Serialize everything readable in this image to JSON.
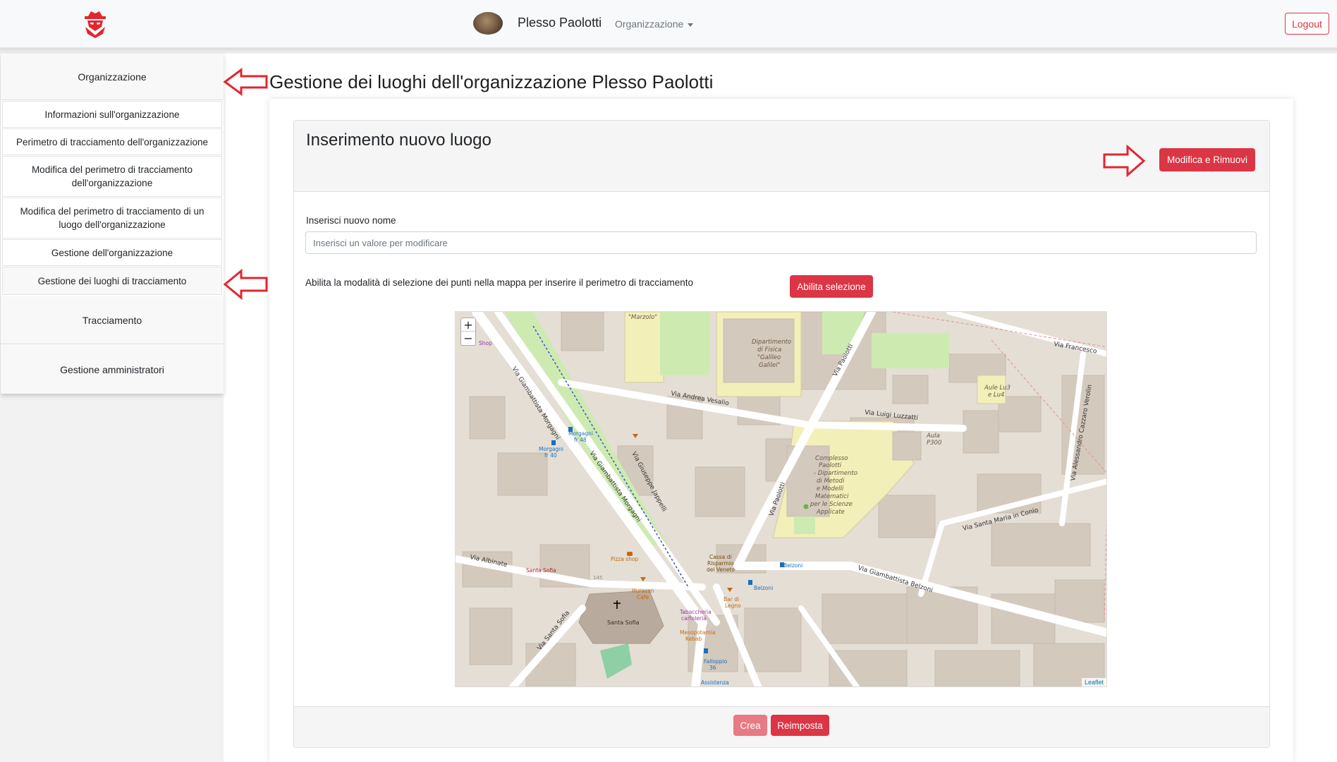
{
  "navbar": {
    "org_name": "Plesso Paolotti",
    "dropdown_label": "Organizzazione",
    "logout_label": "Logout"
  },
  "sidebar": {
    "section_org": "Organizzazione",
    "items": [
      {
        "label": "Informazioni sull'organizzazione"
      },
      {
        "label": "Perimetro di tracciamento dell'organizzazione"
      },
      {
        "label": "Modifica del perimetro di tracciamento dell'organizzazione"
      },
      {
        "label": "Modifica del perimetro di tracciamento di un luogo dell'organizzazione"
      },
      {
        "label": "Gestione dell'organizzazione"
      },
      {
        "label": "Gestione dei luoghi di tracciamento"
      }
    ],
    "section_tracking": "Tracciamento",
    "section_admins": "Gestione amministratori"
  },
  "main": {
    "page_title": "Gestione dei luoghi dell'organizzazione Plesso Paolotti",
    "card_title": "Inserimento nuovo luogo",
    "edit_remove_label": "Modifica e Rimuovi",
    "name_label": "Inserisci nuovo nome",
    "name_placeholder": "Inserisci un valore per modificare",
    "select_mode_text": "Abilita la modalità di selezione dei punti nella mappa per inserire il perimetro di tracciamento",
    "enable_selection_label": "Abilita selezione",
    "create_label": "Crea",
    "reset_label": "Reimposta"
  },
  "map": {
    "zoom_in": "+",
    "zoom_out": "−",
    "attribution": "Leaflet",
    "labels": {
      "via_andrea_vesalio": "Via Andrea Vesalio",
      "via_luigi_luzzatti": "Via Luigi Luzzatti",
      "via_paolotti": "Via Paolotti",
      "via_francesco": "Via Francesco",
      "via_alessandro_cazzaro_verolin": "Via Alessandro Cazzaro Verolin",
      "via_santa_maria_in_conio": "Via Santa Maria in Conio",
      "via_giambattista_belzoni": "Via Giambattista Belzoni",
      "via_giambattista_morgagni": "Via Giambattista Morgagni",
      "via_giuseppe_jappelli": "Via Giuseppe Jappelli",
      "via_albinate": "Via Albinate",
      "via_santa_sofia": "Via Santa Sofia",
      "dipartimento_fisica": "Dipartimento di Fisica \"Galileo Galilei\"",
      "dipartimento_fisica_l1": "Dipartimento",
      "dipartimento_fisica_l2": "di Fisica",
      "dipartimento_fisica_l3": "\"Galileo",
      "dipartimento_fisica_l4": "Galilei\"",
      "marzolo": "\"Marzolo\"",
      "aule": "Aule Lu3 e Lu4",
      "aule_l1": "Aule Lu3",
      "aule_l2": "e Lu4",
      "aula_p300": "Aula P300",
      "aula_p300_l1": "Aula",
      "aula_p300_l2": "P300",
      "complesso_paolotti": "Complesso Paolotti - Dipartimento di Metodi e Modelli Matematici per le Scienze Applicate",
      "complesso_l1": "Complesso",
      "complesso_l2": "Paolotti",
      "complesso_l3": "- Dipartimento",
      "complesso_l4": "di Metodi",
      "complesso_l5": "e Modelli",
      "complesso_l6": "Matematici",
      "complesso_l7": "per le Scienze",
      "complesso_l8": "Applicate",
      "morgagni_fr48": "Morgagni fr 48",
      "morgagni_fr48_l1": "Morgagni",
      "morgagni_fr48_l2": "fr 48",
      "morgagni_fr40": "Morgagni fr 40",
      "morgagni_fr40_l1": "Morgagni",
      "morgagni_fr40_l2": "fr 40",
      "santa_sofia": "Santa Sofia",
      "santa_sofia_top": "Santa Sofia",
      "pizza_shop": "Pizza shop",
      "huracan_cafe": "Huracan Cafe",
      "huracan_l1": "Huracan",
      "huracan_l2": "Cafe",
      "tabaccheria": "Tabaccheria cartoleria",
      "tabaccheria_l1": "Tabaccheria",
      "tabaccheria_l2": "cartoleria",
      "mesopotamia": "Mesopotamia Kebab",
      "mesopotamia_l1": "Mesopotamia",
      "mesopotamia_l2": "Kebab",
      "cassa_risparmio": "Cassa di Risparmio del Veneto",
      "cassa_l1": "Cassa di",
      "cassa_l2": "Risparmio",
      "cassa_l3": "del Veneto",
      "bar_legno": "Bar di Legno",
      "bar_legno_l1": "Bar di",
      "bar_legno_l2": "Legno",
      "belzoni": "Belzoni",
      "belzoni_2": "Belzoni",
      "falloppio": "Falloppio 36",
      "falloppio_l1": "Falloppio",
      "falloppio_l2": "36",
      "assistenza": "Assistenza",
      "shop": "Shop",
      "num_145": "145"
    }
  }
}
